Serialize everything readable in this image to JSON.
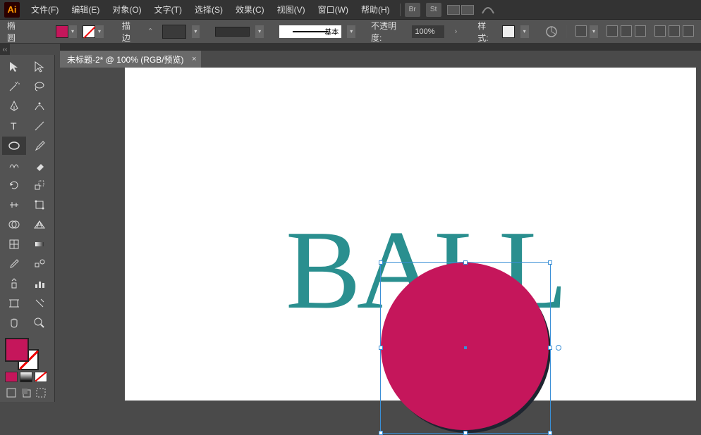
{
  "app": {
    "logo_text": "Ai"
  },
  "menu": {
    "file": "文件(F)",
    "edit": "编辑(E)",
    "object": "对象(O)",
    "type": "文字(T)",
    "select": "选择(S)",
    "effect": "效果(C)",
    "view": "视图(V)",
    "window": "窗口(W)",
    "help": "帮助(H)"
  },
  "top_icons": {
    "br": "Br",
    "st": "St"
  },
  "ctrl": {
    "shape_label": "椭圆",
    "stroke_label": "描边",
    "brush_label": "基本",
    "opacity_label": "不透明度:",
    "opacity_value": "100%",
    "style_label": "样式:"
  },
  "doc": {
    "tab_title": "未标题-2* @ 100% (RGB/预览)",
    "close": "×"
  },
  "canvas": {
    "text": "BALL"
  },
  "colors": {
    "fill": "#c5165b",
    "text": "#2a8f8f"
  },
  "tools": {
    "active": "ellipse"
  }
}
